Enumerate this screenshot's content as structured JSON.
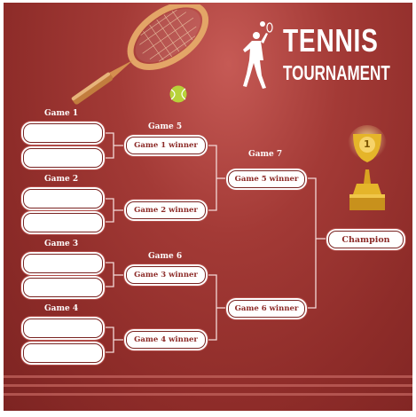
{
  "header": {
    "title_line1": "TENNIS",
    "title_line2": "TOURNAMENT"
  },
  "groups": {
    "game1": "Game 1",
    "game2": "Game 2",
    "game3": "Game 3",
    "game4": "Game 4",
    "game5": "Game 5",
    "game6": "Game 6",
    "game7": "Game 7"
  },
  "slots": {
    "game1_winner": "Game 1 winner",
    "game2_winner": "Game 2 winner",
    "game3_winner": "Game 3 winner",
    "game4_winner": "Game 4 winner",
    "game5_winner": "Game 5 winner",
    "game6_winner": "Game 6 winner",
    "champion": "Champion"
  },
  "trophy": {
    "rank": "1"
  },
  "colors": {
    "background": "#a33a36",
    "accent": "#8c2a27",
    "trophy_gold": "#e5b52a"
  },
  "icons": [
    "tennis-racket-icon",
    "tennis-ball-icon",
    "tennis-player-icon",
    "trophy-icon"
  ]
}
